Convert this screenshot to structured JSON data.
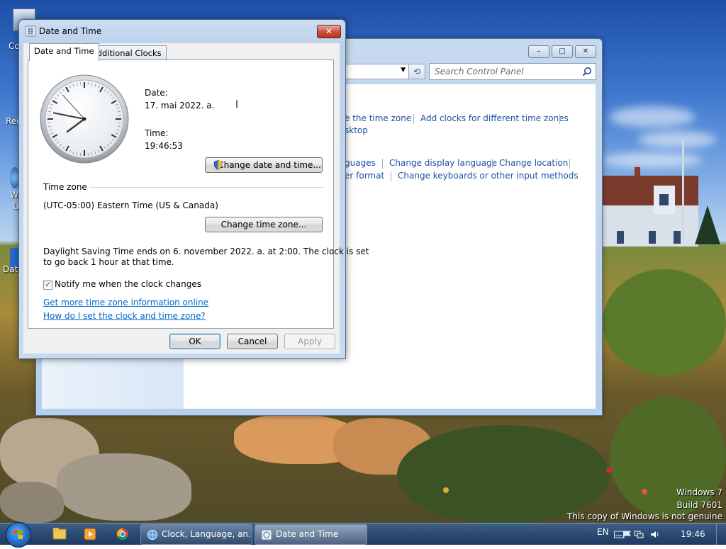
{
  "desktop": {
    "icon_labels": [
      "Co",
      "Rec",
      "W",
      "U",
      "Data"
    ],
    "watermark": {
      "line1": "Windows 7",
      "line2": "Build 7601",
      "line3": "This copy of Windows is not genuine"
    }
  },
  "control_panel": {
    "search_placeholder": "Search Control Panel",
    "caption_buttons": {
      "minimize": "–",
      "maximize": "□",
      "close": "✕"
    },
    "refresh_glyph": "⟲",
    "links": {
      "change_time_zone": "e the time zone",
      "add_clocks": "Add clocks for different time zones",
      "desktop": "sktop",
      "languages": "guages",
      "change_display_language": "Change display language",
      "change_location": "Change location",
      "number_format": "er format",
      "change_keyboards": "Change keyboards or other input methods"
    }
  },
  "dialog": {
    "title": "Date and Time",
    "close_glyph": "✕",
    "tabs": [
      "Date and Time",
      "Additional Clocks"
    ],
    "date_label": "Date:",
    "date_value": "17. mai 2022. a.",
    "time_label": "Time:",
    "time_value": "19:46:53",
    "clock": {
      "hours": 19,
      "minutes": 46,
      "seconds": 53
    },
    "change_date_time_button": "Change date and time...",
    "time_zone_heading": "Time zone",
    "time_zone_value": "(UTC-05:00) Eastern Time (US & Canada)",
    "change_time_zone_button": "Change time zone...",
    "dst_line1": "Daylight Saving Time ends on 6. november 2022. a. at 2:00. The clock is set",
    "dst_line2": "to go back 1 hour at that time.",
    "notify_checkbox_label": "Notify me when the clock changes",
    "notify_checked": true,
    "check_glyph": "✓",
    "link_more_info": "Get more time zone information online",
    "link_how_to": "How do I set the clock and time zone?",
    "ok_button": "OK",
    "cancel_button": "Cancel",
    "apply_button": "Apply"
  },
  "taskbar": {
    "tasks": [
      {
        "label": "Clock, Language, an...",
        "icon": "globe-clock-icon"
      },
      {
        "label": "Date and Time",
        "icon": "clock-icon"
      }
    ],
    "language": "EN",
    "time": "19:46"
  },
  "colors": {
    "link_blue": "#0066cc",
    "cp_link_blue": "#1e50a2",
    "taskbar": "#2a4a72",
    "close_red": "#c8402a"
  }
}
